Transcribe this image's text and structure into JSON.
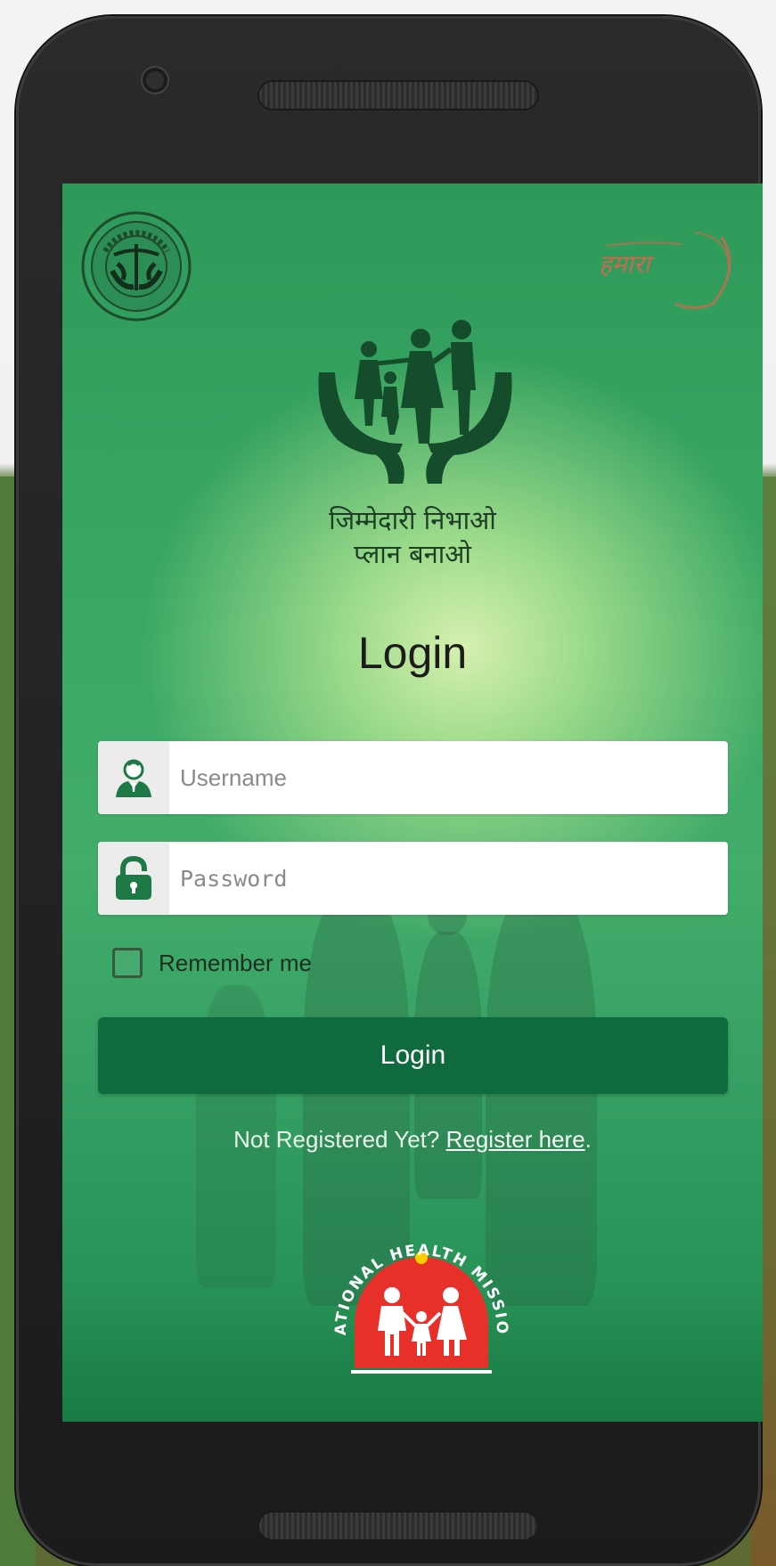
{
  "colors": {
    "screen_green": "#3aa864",
    "button_green": "#0f6a3d",
    "nhm_red": "#e8302a",
    "brand_accent": "#c76a4f"
  },
  "header": {
    "left_logo_icon": "up-government-emblem-icon",
    "right_logo_icon": "campaign-logo-icon"
  },
  "hero": {
    "logo_icon": "family-in-hands-icon",
    "tagline_line1": "जिम्मेदारी निभाओ",
    "tagline_line2": "प्लान बनाओ"
  },
  "form": {
    "title": "Login",
    "username": {
      "icon": "user-icon",
      "placeholder": "Username",
      "value": ""
    },
    "password": {
      "icon": "lock-icon",
      "placeholder": "Password",
      "value": ""
    },
    "remember_me": {
      "label": "Remember me",
      "checked": false
    },
    "submit_label": "Login",
    "register_prompt": "Not Registered Yet?",
    "register_link": "Register here",
    "register_suffix": "."
  },
  "footer": {
    "logo_icon": "national-health-mission-logo-icon",
    "logo_text": "NATIONAL HEALTH MISSION"
  }
}
